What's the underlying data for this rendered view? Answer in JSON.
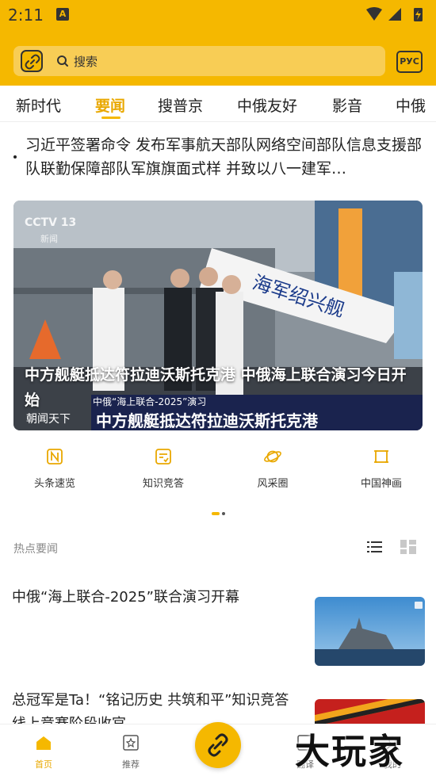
{
  "status_bar": {
    "time": "2:11",
    "notification_letter": "A"
  },
  "header": {
    "search_placeholder": "搜索",
    "lang_button": "РУС"
  },
  "tabs": [
    "新时代",
    "要闻",
    "搜普京",
    "中俄友好",
    "影音",
    "中俄"
  ],
  "active_tab_index": 1,
  "headline": "习近平签署命令 发布军事航天部队网络空间部队信息支援部队联勤保障部队军旗旗面式样 并致以八一建军…",
  "banner": {
    "caption": "中方舰艇抵达符拉迪沃斯托克港 中俄海上联合演习今日开始",
    "cctv_logo": "CCTV 13",
    "cctv_sub": "新闻",
    "lower_third_top": "中俄“海上联合-2025”演习",
    "lower_third_main": "中方舰艇抵达符拉迪沃斯托克港",
    "lower_third_left": "朝闻天下",
    "ship_banner": "海军绍兴舰"
  },
  "quick_links": [
    {
      "label": "头条速览",
      "icon": "news-n-icon"
    },
    {
      "label": "知识竞答",
      "icon": "quiz-icon"
    },
    {
      "label": "风采圈",
      "icon": "planet-icon"
    },
    {
      "label": "中国神画",
      "icon": "scroll-painting-icon"
    }
  ],
  "section_title": "热点要闻",
  "news": [
    {
      "title": "中俄“海上联合-2025”联合演习开幕"
    },
    {
      "title": "总冠军是Ta！“铭记历史 共筑和平”知识竞答线上竞赛阶段收官"
    }
  ],
  "bottom_nav": [
    {
      "label": "首页",
      "icon": "home-icon"
    },
    {
      "label": "推荐",
      "icon": "star-icon"
    },
    {
      "label": "翻译",
      "icon": "translate-icon"
    },
    {
      "label": "我的",
      "icon": "profile-icon"
    }
  ],
  "watermark": "大玩家",
  "colors": {
    "accent": "#f5b800",
    "active_text": "#e9a800"
  }
}
